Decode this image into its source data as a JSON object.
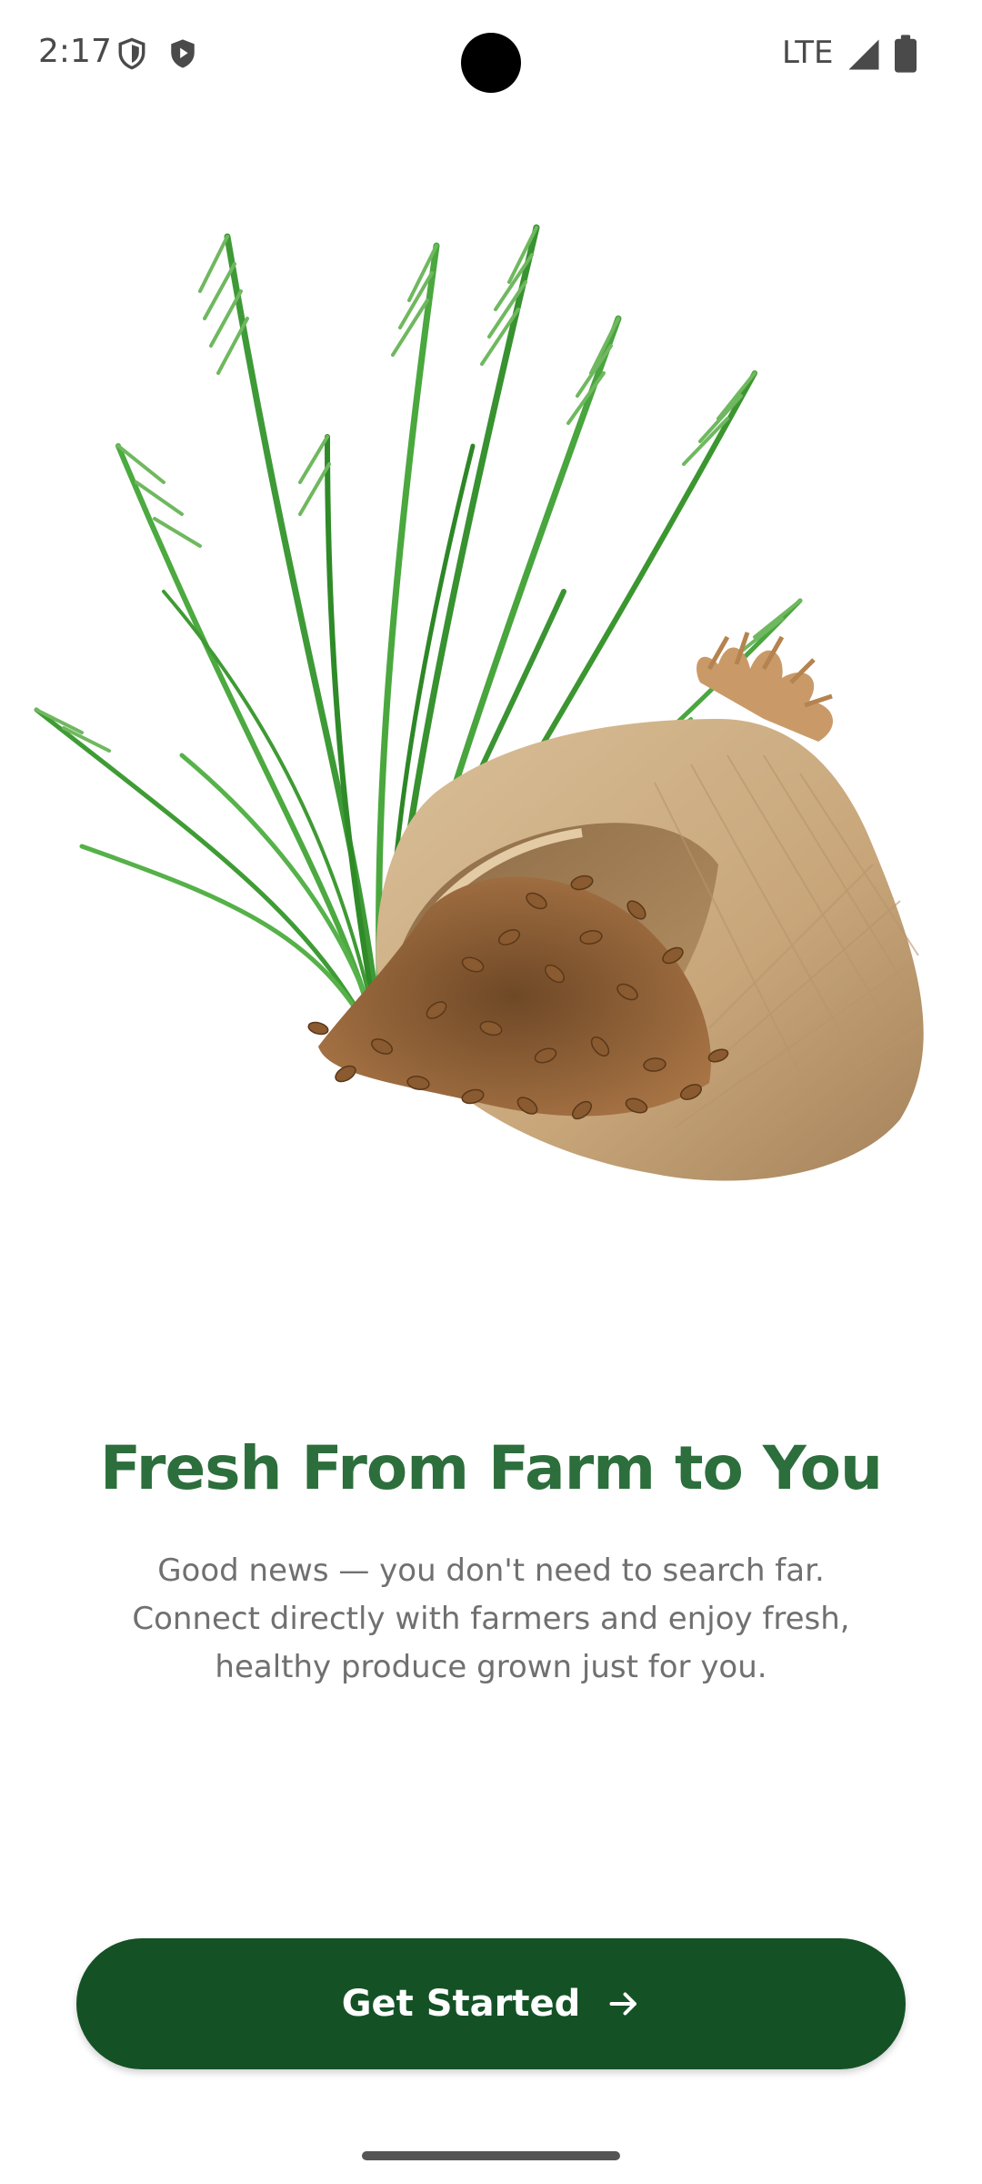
{
  "status_bar": {
    "time": "2:17",
    "network": "LTE",
    "icons": [
      "shield-icon",
      "play-protect-icon",
      "signal-icon",
      "battery-icon"
    ]
  },
  "hero_image": {
    "subject": "grass-and-grain-sack-illustration"
  },
  "onboarding": {
    "title": "Fresh From Farm to You",
    "description": "Good news — you don't need to search far. Connect directly with farmers and enjoy fresh, healthy produce grown just for you.",
    "cta_label": "Get Started",
    "cta_icon": "arrow-right-icon"
  },
  "colors": {
    "title_green": "#2c6e3c",
    "button_green": "#145226",
    "body_text": "#707070",
    "background": "#ffffff"
  }
}
